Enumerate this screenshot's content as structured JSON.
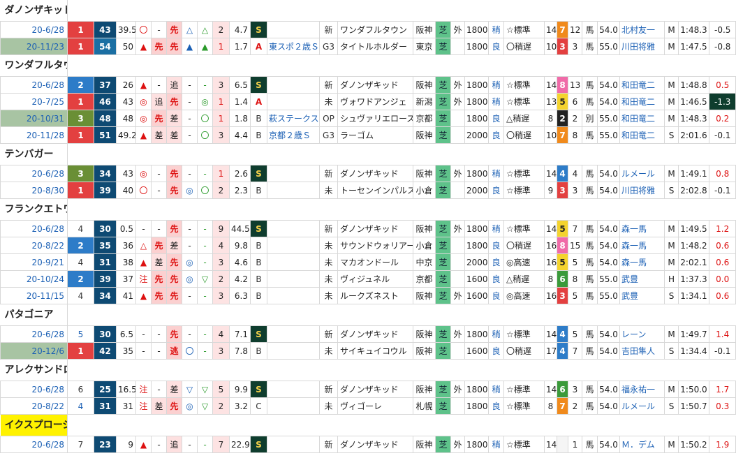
{
  "horses": [
    {
      "name": "ダノンザキッド",
      "highlight": false,
      "rows": [
        {
          "date": "20-6/28",
          "hl": false,
          "wk": "1",
          "wkc": "wk1",
          "sp": "43",
          "spc": "c",
          "idx": "39.5",
          "m1": "〇",
          "m2": "-",
          "m3": "先",
          "m4": "△",
          "m5": "△",
          "rank": "2",
          "odds": "4.7",
          "grade": "S",
          "race": "",
          "cls": "新",
          "opp": "ワンダフルタウン",
          "venue": "阪神",
          "surf": "芝",
          "io": "外",
          "dist": "1800",
          "cond": "稍",
          "pace": "☆標準",
          "heads": "14",
          "umaban": "7",
          "ubc": "u7",
          "pop": "12",
          "sex": "馬",
          "wt": "54.0",
          "jockey": "北村友一",
          "mark": "M",
          "time": "1:48.3",
          "diff": "-0.5"
        },
        {
          "date": "20-11/23",
          "hl": true,
          "wk": "1",
          "wkc": "wk1",
          "sp": "54",
          "spc": "b",
          "idx": "50",
          "m1": "▲",
          "m2": "先",
          "m3": "先",
          "m4": "▲",
          "m5": "▲",
          "rank": "1",
          "odds": "1.7",
          "grade": "A",
          "race": "東スポ２歳Ｓ",
          "cls": "G3",
          "opp": "タイトルホルダー",
          "venue": "東京",
          "surf": "芝",
          "io": "",
          "dist": "1800",
          "cond": "良",
          "pace": "〇稍遅",
          "heads": "10",
          "umaban": "3",
          "ubc": "u3",
          "pop": "3",
          "sex": "馬",
          "wt": "55.0",
          "jockey": "川田将雅",
          "mark": "M",
          "time": "1:47.5",
          "diff": "-0.8"
        }
      ]
    },
    {
      "name": "ワンダフルタウン",
      "highlight": false,
      "rows": [
        {
          "date": "20-6/28",
          "hl": false,
          "wk": "2",
          "wkc": "wk2",
          "sp": "37",
          "spc": "c",
          "idx": "26",
          "m1": "▲",
          "m2": "-",
          "m3": "追",
          "m4": "-",
          "m5": "-",
          "rank": "3",
          "odds": "6.5",
          "grade": "S",
          "race": "",
          "cls": "新",
          "opp": "ダノンザキッド",
          "venue": "阪神",
          "surf": "芝",
          "io": "外",
          "dist": "1800",
          "cond": "稍",
          "pace": "☆標準",
          "heads": "14",
          "umaban": "8",
          "ubc": "u8",
          "pop": "13",
          "sex": "馬",
          "wt": "54.0",
          "jockey": "和田竜二",
          "mark": "M",
          "time": "1:48.8",
          "diff": "0.5"
        },
        {
          "date": "20-7/25",
          "hl": false,
          "wk": "1",
          "wkc": "wk1",
          "sp": "46",
          "spc": "c",
          "idx": "43",
          "m1": "◎",
          "m2": "追",
          "m3": "先",
          "m4": "-",
          "m5": "◎",
          "rank": "1",
          "odds": "1.4",
          "grade": "A",
          "race": "",
          "cls": "未",
          "opp": "ヴォワドアンジェ",
          "venue": "新潟",
          "surf": "芝",
          "io": "外",
          "dist": "1800",
          "cond": "稍",
          "pace": "☆標準",
          "heads": "13",
          "umaban": "5",
          "ubc": "u5",
          "pop": "6",
          "sex": "馬",
          "wt": "54.0",
          "jockey": "和田竜二",
          "mark": "M",
          "time": "1:46.5",
          "diff": "-1.3"
        },
        {
          "date": "20-10/31",
          "hl": true,
          "wk": "3",
          "wkc": "wk3",
          "sp": "48",
          "spc": "c",
          "idx": "48",
          "m1": "◎",
          "m2": "先",
          "m3": "差",
          "m4": "-",
          "m5": "〇",
          "rank": "1",
          "odds": "1.8",
          "grade": "B",
          "race": "萩ステークス",
          "cls": "OP",
          "opp": "シュヴァリエローズ",
          "venue": "京都",
          "surf": "芝",
          "io": "",
          "dist": "1800",
          "cond": "良",
          "pace": "△稍遅",
          "heads": "8",
          "umaban": "2",
          "ubc": "u2",
          "pop": "2",
          "sex": "別",
          "wt": "55.0",
          "jockey": "和田竜二",
          "mark": "M",
          "time": "1:48.3",
          "diff": "0.2"
        },
        {
          "date": "20-11/28",
          "hl": false,
          "wk": "1",
          "wkc": "wk1",
          "sp": "51",
          "spc": "c",
          "idx": "49.2",
          "m1": "▲",
          "m2": "差",
          "m3": "差",
          "m4": "-",
          "m5": "〇",
          "rank": "3",
          "odds": "4.4",
          "grade": "B",
          "race": "京都２歳Ｓ",
          "cls": "G3",
          "opp": "ラーゴム",
          "venue": "阪神",
          "surf": "芝",
          "io": "",
          "dist": "2000",
          "cond": "良",
          "pace": "〇稍遅",
          "heads": "10",
          "umaban": "7",
          "ubc": "u7",
          "pop": "8",
          "sex": "馬",
          "wt": "55.0",
          "jockey": "和田竜二",
          "mark": "S",
          "time": "2:01.6",
          "diff": "-0.1"
        }
      ]
    },
    {
      "name": "テンバガー",
      "highlight": false,
      "rows": [
        {
          "date": "20-6/28",
          "hl": false,
          "wk": "3",
          "wkc": "wk3",
          "sp": "34",
          "spc": "c",
          "idx": "43",
          "m1": "◎",
          "m2": "-",
          "m3": "先",
          "m4": "-",
          "m5": "-",
          "rank": "1",
          "odds": "2.6",
          "grade": "S",
          "race": "",
          "cls": "新",
          "opp": "ダノンザキッド",
          "venue": "阪神",
          "surf": "芝",
          "io": "外",
          "dist": "1800",
          "cond": "稍",
          "pace": "☆標準",
          "heads": "14",
          "umaban": "4",
          "ubc": "u4",
          "pop": "4",
          "sex": "馬",
          "wt": "54.0",
          "jockey": "ルメール",
          "mark": "M",
          "time": "1:49.1",
          "diff": "0.8"
        },
        {
          "date": "20-8/30",
          "hl": false,
          "wk": "1",
          "wkc": "wk1",
          "sp": "39",
          "spc": "c",
          "idx": "40",
          "m1": "〇",
          "m2": "-",
          "m3": "先",
          "m4": "◎",
          "m5": "〇",
          "rank": "2",
          "odds": "2.3",
          "grade": "B",
          "race": "",
          "cls": "未",
          "opp": "トーセンインパルス",
          "venue": "小倉",
          "surf": "芝",
          "io": "",
          "dist": "2000",
          "cond": "良",
          "pace": "☆標準",
          "heads": "9",
          "umaban": "3",
          "ubc": "u3",
          "pop": "3",
          "sex": "馬",
          "wt": "54.0",
          "jockey": "川田将雅",
          "mark": "S",
          "time": "2:02.8",
          "diff": "-0.1"
        }
      ]
    },
    {
      "name": "フランクエトワール",
      "highlight": false,
      "rows": [
        {
          "date": "20-6/28",
          "hl": false,
          "wk": "4",
          "wkc": "wk4",
          "sp": "30",
          "spc": "c",
          "idx": "0.5",
          "m1": "-",
          "m2": "-",
          "m3": "先",
          "m4": "-",
          "m5": "-",
          "rank": "9",
          "odds": "44.5",
          "grade": "S",
          "race": "",
          "cls": "新",
          "opp": "ダノンザキッド",
          "venue": "阪神",
          "surf": "芝",
          "io": "外",
          "dist": "1800",
          "cond": "稍",
          "pace": "☆標準",
          "heads": "14",
          "umaban": "5",
          "ubc": "u5",
          "pop": "7",
          "sex": "馬",
          "wt": "54.0",
          "jockey": "森一馬",
          "mark": "M",
          "time": "1:49.5",
          "diff": "1.2"
        },
        {
          "date": "20-8/22",
          "hl": false,
          "wk": "2",
          "wkc": "wk2",
          "sp": "35",
          "spc": "c",
          "idx": "36",
          "m1": "△",
          "m2": "先",
          "m3": "差",
          "m4": "-",
          "m5": "-",
          "rank": "4",
          "odds": "9.8",
          "grade": "B",
          "race": "",
          "cls": "未",
          "opp": "サウンドウォリアー",
          "venue": "小倉",
          "surf": "芝",
          "io": "",
          "dist": "1800",
          "cond": "良",
          "pace": "〇稍遅",
          "heads": "16",
          "umaban": "8",
          "ubc": "u8",
          "pop": "15",
          "sex": "馬",
          "wt": "54.0",
          "jockey": "森一馬",
          "mark": "M",
          "time": "1:48.2",
          "diff": "0.6"
        },
        {
          "date": "20-9/21",
          "hl": false,
          "wk": "4",
          "wkc": "wk4",
          "sp": "31",
          "spc": "c",
          "idx": "38",
          "m1": "▲",
          "m2": "差",
          "m3": "先",
          "m4": "◎",
          "m5": "-",
          "rank": "3",
          "odds": "4.6",
          "grade": "B",
          "race": "",
          "cls": "未",
          "opp": "マカオンドール",
          "venue": "中京",
          "surf": "芝",
          "io": "",
          "dist": "2000",
          "cond": "良",
          "pace": "◎高速",
          "heads": "16",
          "umaban": "5",
          "ubc": "u5",
          "pop": "5",
          "sex": "馬",
          "wt": "54.0",
          "jockey": "森一馬",
          "mark": "M",
          "time": "2:02.1",
          "diff": "0.6"
        },
        {
          "date": "20-10/24",
          "hl": false,
          "wk": "2",
          "wkc": "wk2",
          "sp": "39",
          "spc": "c",
          "idx": "37",
          "m1": "注",
          "m2": "先",
          "m3": "先",
          "m4": "◎",
          "m5": "▽",
          "rank": "2",
          "odds": "4.2",
          "grade": "B",
          "race": "",
          "cls": "未",
          "opp": "ヴィジュネル",
          "venue": "京都",
          "surf": "芝",
          "io": "",
          "dist": "1600",
          "cond": "良",
          "pace": "△稍遅",
          "heads": "8",
          "umaban": "6",
          "ubc": "u6",
          "pop": "8",
          "sex": "馬",
          "wt": "55.0",
          "jockey": "武豊",
          "mark": "H",
          "time": "1:37.3",
          "diff": "0.0"
        },
        {
          "date": "20-11/15",
          "hl": false,
          "wk": "4",
          "wkc": "wk4",
          "sp": "34",
          "spc": "c",
          "idx": "41",
          "m1": "▲",
          "m2": "先",
          "m3": "先",
          "m4": "-",
          "m5": "-",
          "rank": "3",
          "odds": "6.3",
          "grade": "B",
          "race": "",
          "cls": "未",
          "opp": "ルークズネスト",
          "venue": "阪神",
          "surf": "芝",
          "io": "外",
          "dist": "1600",
          "cond": "良",
          "pace": "◎高速",
          "heads": "16",
          "umaban": "3",
          "ubc": "u3",
          "pop": "5",
          "sex": "馬",
          "wt": "55.0",
          "jockey": "武豊",
          "mark": "S",
          "time": "1:34.1",
          "diff": "0.6"
        }
      ]
    },
    {
      "name": "パタゴニア",
      "highlight": false,
      "rows": [
        {
          "date": "20-6/28",
          "hl": false,
          "wk": "5",
          "wkc": "wk5",
          "sp": "30",
          "spc": "c",
          "idx": "6.5",
          "m1": "-",
          "m2": "-",
          "m3": "先",
          "m4": "-",
          "m5": "-",
          "rank": "4",
          "odds": "7.1",
          "grade": "S",
          "race": "",
          "cls": "新",
          "opp": "ダノンザキッド",
          "venue": "阪神",
          "surf": "芝",
          "io": "外",
          "dist": "1800",
          "cond": "稍",
          "pace": "☆標準",
          "heads": "14",
          "umaban": "4",
          "ubc": "u4",
          "pop": "5",
          "sex": "馬",
          "wt": "54.0",
          "jockey": "レーン",
          "mark": "M",
          "time": "1:49.7",
          "diff": "1.4"
        },
        {
          "date": "20-12/6",
          "hl": true,
          "wk": "1",
          "wkc": "wk1",
          "sp": "42",
          "spc": "c",
          "idx": "35",
          "m1": "-",
          "m2": "-",
          "m3": "逃",
          "m4": "〇",
          "m5": "-",
          "rank": "3",
          "odds": "7.8",
          "grade": "B",
          "race": "",
          "cls": "未",
          "opp": "サイキュイコウル",
          "venue": "阪神",
          "surf": "芝",
          "io": "",
          "dist": "1600",
          "cond": "良",
          "pace": "〇稍遅",
          "heads": "17",
          "umaban": "4",
          "ubc": "u4",
          "pop": "7",
          "sex": "馬",
          "wt": "54.0",
          "jockey": "吉田隼人",
          "mark": "S",
          "time": "1:34.4",
          "diff": "-0.1"
        }
      ]
    },
    {
      "name": "アレクサンドロス",
      "highlight": false,
      "rows": [
        {
          "date": "20-6/28",
          "hl": false,
          "wk": "6",
          "wkc": "wk6",
          "sp": "25",
          "spc": "c",
          "idx": "16.5",
          "m1": "注",
          "m2": "-",
          "m3": "差",
          "m4": "▽",
          "m5": "▽",
          "rank": "5",
          "odds": "9.9",
          "grade": "S",
          "race": "",
          "cls": "新",
          "opp": "ダノンザキッド",
          "venue": "阪神",
          "surf": "芝",
          "io": "外",
          "dist": "1800",
          "cond": "稍",
          "pace": "☆標準",
          "heads": "14",
          "umaban": "6",
          "ubc": "u6",
          "pop": "3",
          "sex": "馬",
          "wt": "54.0",
          "jockey": "福永祐一",
          "mark": "M",
          "time": "1:50.0",
          "diff": "1.7"
        },
        {
          "date": "20-8/22",
          "hl": false,
          "wk": "4",
          "wkc": "wk5",
          "sp": "31",
          "spc": "c",
          "idx": "31",
          "m1": "注",
          "m2": "差",
          "m3": "先",
          "m4": "◎",
          "m5": "▽",
          "rank": "2",
          "odds": "3.2",
          "grade": "C",
          "race": "",
          "cls": "未",
          "opp": "ヴィゴーレ",
          "venue": "札幌",
          "surf": "芝",
          "io": "",
          "dist": "1800",
          "cond": "良",
          "pace": "☆標準",
          "heads": "8",
          "umaban": "7",
          "ubc": "u7",
          "pop": "2",
          "sex": "馬",
          "wt": "54.0",
          "jockey": "ルメール",
          "mark": "S",
          "time": "1:50.7",
          "diff": "0.3"
        }
      ]
    },
    {
      "name": "イクスプロージョン",
      "highlight": true,
      "rows": [
        {
          "date": "20-6/28",
          "hl": false,
          "wk": "7",
          "wkc": "wk7",
          "sp": "23",
          "spc": "c",
          "idx": "9",
          "m1": "▲",
          "m2": "-",
          "m3": "追",
          "m4": "-",
          "m5": "-",
          "rank": "7",
          "odds": "22.9",
          "grade": "S",
          "race": "",
          "cls": "新",
          "opp": "ダノンザキッド",
          "venue": "阪神",
          "surf": "芝",
          "io": "外",
          "dist": "1800",
          "cond": "稍",
          "pace": "☆標準",
          "heads": "14",
          "umaban": "",
          "ubc": "u1",
          "pop": "1",
          "sex": "馬",
          "wt": "54.0",
          "jockey": "Ｍ．デム",
          "mark": "M",
          "time": "1:50.2",
          "diff": "1.9"
        }
      ]
    }
  ]
}
